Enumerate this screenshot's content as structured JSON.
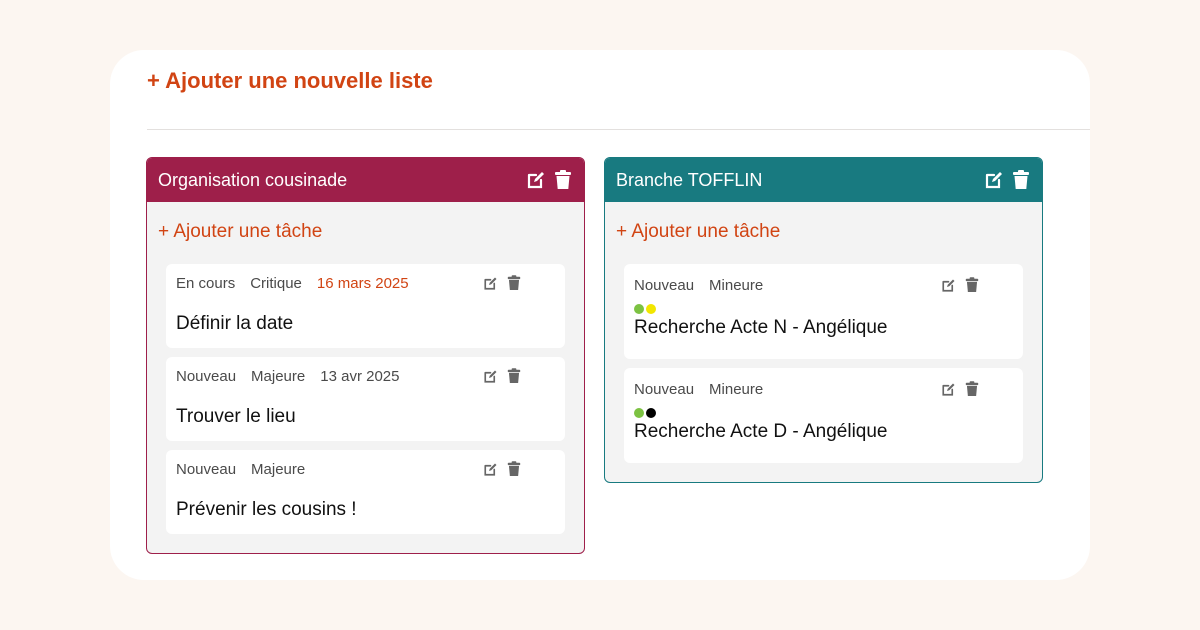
{
  "page": {
    "add_list_label": "+ Ajouter une nouvelle liste"
  },
  "lists": [
    {
      "title": "Organisation cousinade",
      "color": "#9e1f4a",
      "add_task_label": "+ Ajouter une tâche",
      "tasks": [
        {
          "status": "En cours",
          "priority": "Critique",
          "date": "16 mars 2025",
          "date_color": "#d14413",
          "title": "Définir la date"
        },
        {
          "status": "Nouveau",
          "priority": "Majeure",
          "date": "13 avr 2025",
          "title": "Trouver le lieu"
        },
        {
          "status": "Nouveau",
          "priority": "Majeure",
          "date": "",
          "title": "Prévenir les cousins !"
        }
      ]
    },
    {
      "title": "Branche TOFFLIN",
      "color": "#187a80",
      "add_task_label": "+ Ajouter une tâche",
      "tasks": [
        {
          "status": "Nouveau",
          "priority": "Mineure",
          "dots": [
            "#7cc242",
            "#f2e600"
          ],
          "title": "Recherche Acte N - Angélique"
        },
        {
          "status": "Nouveau",
          "priority": "Mineure",
          "dots": [
            "#7cc242",
            "#000000"
          ],
          "title": "Recherche Acte D - Angélique"
        }
      ]
    }
  ],
  "icons": {
    "edit": "edit-icon",
    "delete": "trash-icon"
  },
  "colors": {
    "accent": "#d14413",
    "background": "#fcf6f1"
  }
}
